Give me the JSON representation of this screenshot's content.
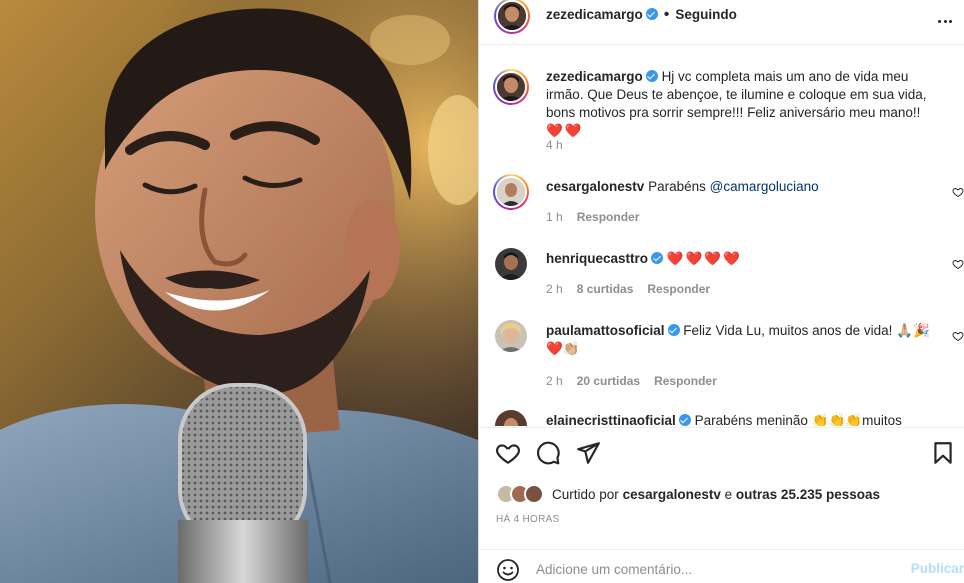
{
  "post": {
    "author": "zezedicamargo",
    "follow_status": "Seguindo",
    "separator": "•",
    "caption": "Hj vc completa mais um ano de vida meu irmão. Que Deus te abençoe, te ilumine e coloque em sua vida, bons motivos pra sorrir sempre!!! Feliz aniversário meu mano!!",
    "caption_emoji": "❤️❤️",
    "caption_time": "4 h"
  },
  "comments": [
    {
      "user": "cesargalonestv",
      "verified": false,
      "text": "Parabéns",
      "mention": "@camargoluciano",
      "time": "1 h",
      "likes": "",
      "reply": "Responder"
    },
    {
      "user": "henriquecasttro",
      "verified": true,
      "text": "",
      "emoji": "❤️❤️❤️❤️",
      "time": "2 h",
      "likes": "8 curtidas",
      "reply": "Responder"
    },
    {
      "user": "paulamattosoficial",
      "verified": true,
      "text": "Feliz Vida Lu, muitos anos de vida!",
      "emoji": "🙏🏼🎉",
      "emoji_line2": "❤️👏🏼",
      "time": "2 h",
      "likes": "20 curtidas",
      "reply": "Responder"
    },
    {
      "user": "elainecristtinaoficial",
      "verified": true,
      "text": "Parabéns meninão",
      "emoji": "👏👏👏muitos"
    }
  ],
  "likes": {
    "prefix": "Curtido por",
    "user": "cesargalonestv",
    "and": "e",
    "others": "outras 25.235 pessoas"
  },
  "timestamp": "HÁ 4 HORAS",
  "add_comment": {
    "placeholder": "Adicione um comentário...",
    "publish_label": "Publicar"
  },
  "icons": {
    "like": "heart-icon",
    "comment": "comment-icon",
    "share": "send-icon",
    "save": "bookmark-icon",
    "more": "more-options-icon",
    "emoji": "emoji-icon"
  },
  "colors": {
    "verified": "#3897f0",
    "link": "#00376b",
    "muted": "#8e8e8e",
    "publish_disabled": "#b2dffc"
  }
}
